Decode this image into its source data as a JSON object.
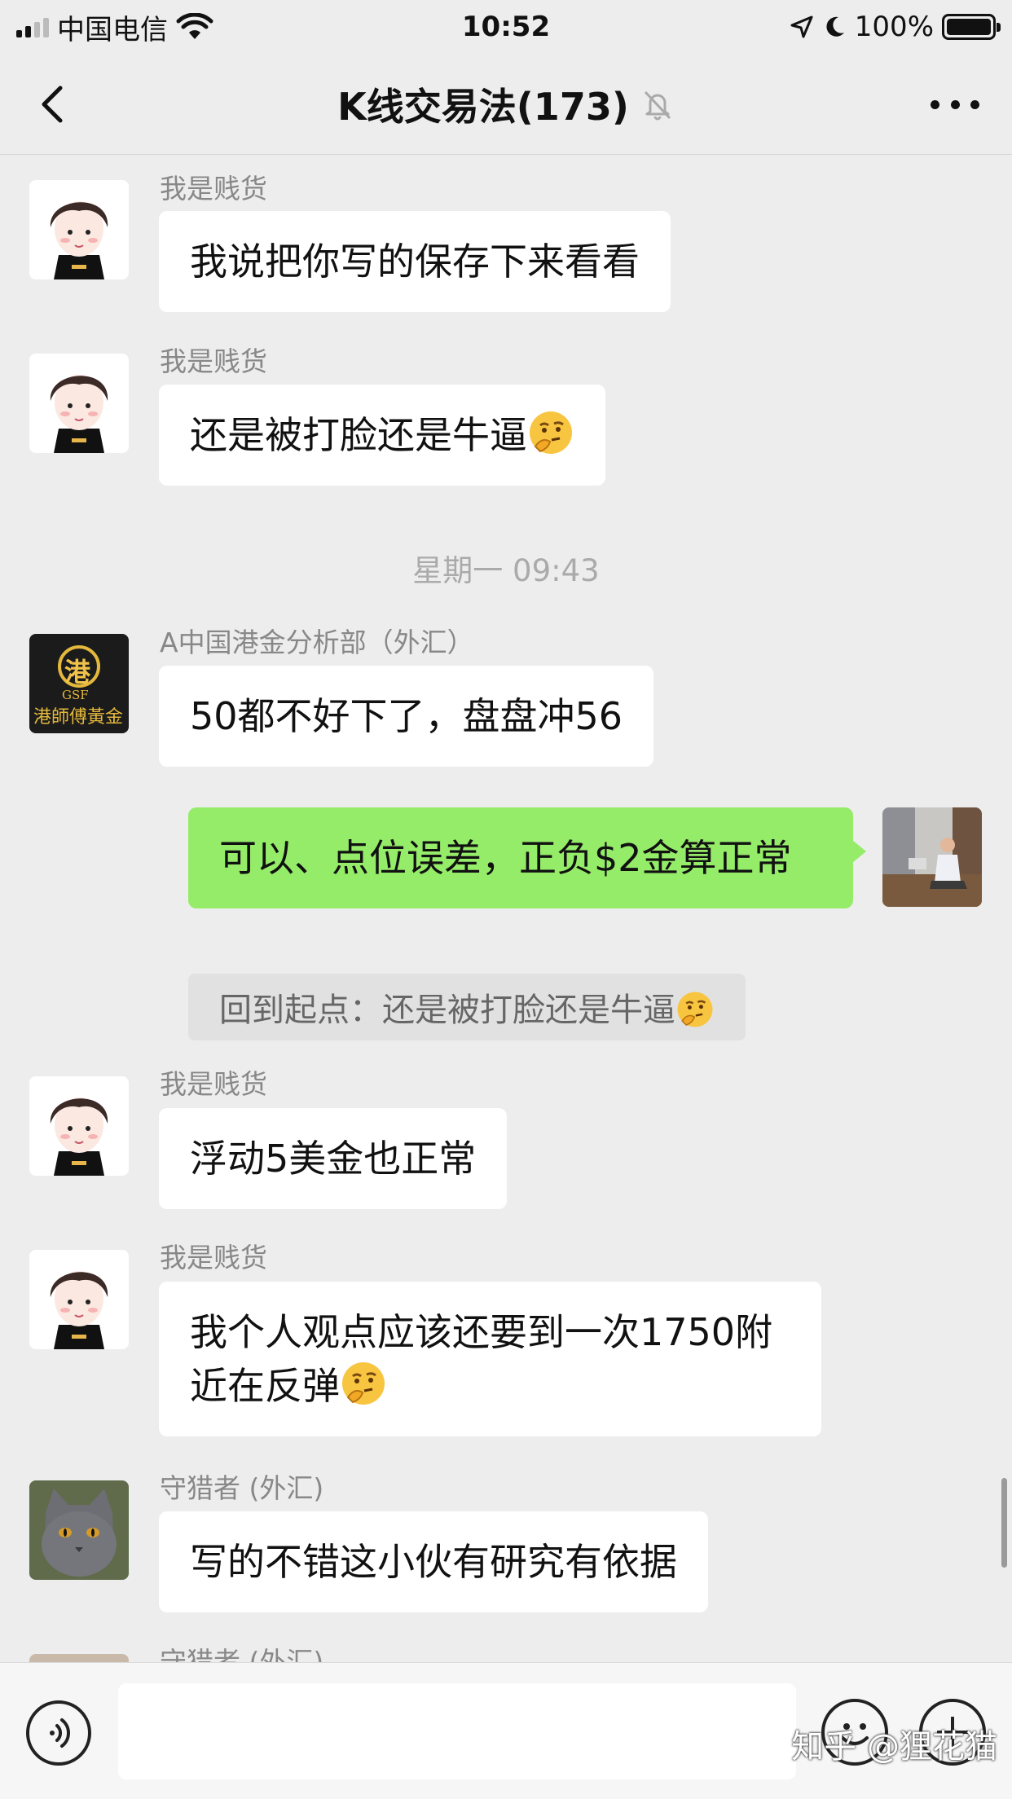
{
  "status_bar": {
    "carrier": "中国电信",
    "time": "10:52",
    "battery": "100%"
  },
  "nav": {
    "title": "K线交易法(173)"
  },
  "messages": [
    {
      "sender": "我是贱货",
      "text": "我说把你写的保存下来看看"
    },
    {
      "sender": "我是贱货",
      "text": "还是被打脸还是牛逼"
    },
    {
      "time_separator": "星期一 09:43"
    },
    {
      "sender": "A中国港金分析部（外汇）",
      "text": "50都不好下了，盘盘冲56",
      "avatar_text": "港",
      "avatar_sub": "GSF",
      "avatar_caption": "港師傅黃金"
    },
    {
      "mine": true,
      "text": "可以、点位误差，正负$2金算正常",
      "quote": "回到起点：还是被打脸还是牛逼"
    },
    {
      "sender": "我是贱货",
      "text": "浮动5美金也正常"
    },
    {
      "sender": "我是贱货",
      "text": "我个人观点应该还要到一次1750附近在反弹"
    },
    {
      "sender": "守猎者 (外汇)",
      "text": "写的不错这小伙有研究有依据"
    },
    {
      "sender": "守猎者 (外汇)"
    }
  ],
  "input_bar": {
    "watermark": "知乎 @狸花猫"
  },
  "colors": {
    "background": "#ededed",
    "my_bubble": "#95ec69",
    "other_bubble": "#ffffff"
  },
  "icons": [
    "back-chevron-icon",
    "mute-bell-icon",
    "more-icon",
    "voice-icon",
    "emoji-face-icon",
    "plus-icon",
    "thinking-emoji-icon"
  ]
}
